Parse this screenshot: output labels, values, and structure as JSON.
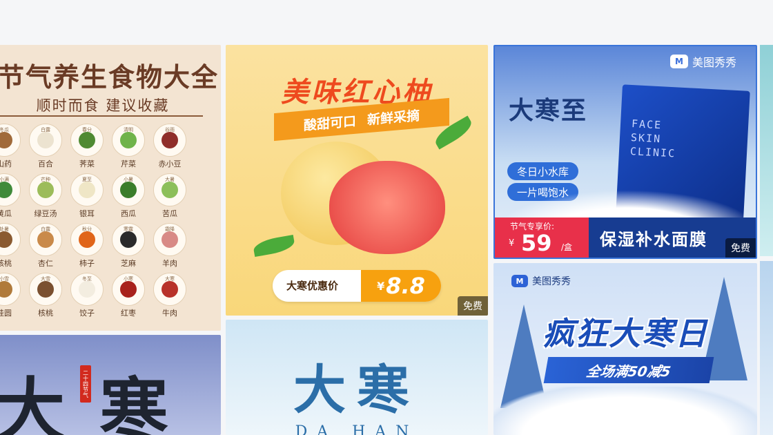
{
  "cards": [
    {
      "title": "节气养生食物大全",
      "subtitle": "顺时而食 建议收藏",
      "foods": [
        {
          "small": "冬瓜",
          "label": "山药",
          "color": "#a06a3a"
        },
        {
          "small": "白露",
          "label": "百合",
          "color": "#ece3d0"
        },
        {
          "small": "春分",
          "label": "荠菜",
          "color": "#4f8a33"
        },
        {
          "small": "清明",
          "label": "芹菜",
          "color": "#6fb34a"
        },
        {
          "small": "谷雨",
          "label": "赤小豆",
          "color": "#8f2e2a"
        },
        {
          "small": "小满",
          "label": "黄瓜",
          "color": "#3f8a3a"
        },
        {
          "small": "芒种",
          "label": "绿豆汤",
          "color": "#9cbc5a"
        },
        {
          "small": "夏至",
          "label": "银耳",
          "color": "#efe6c6"
        },
        {
          "small": "小暑",
          "label": "西瓜",
          "color": "#3a7d2a"
        },
        {
          "small": "大暑",
          "label": "苦瓜",
          "color": "#8cbf5a"
        },
        {
          "small": "处暑",
          "label": "核桃",
          "color": "#8a5a30"
        },
        {
          "small": "白露",
          "label": "杏仁",
          "color": "#c98a4a"
        },
        {
          "small": "秋分",
          "label": "柿子",
          "color": "#e0651a"
        },
        {
          "small": "寒露",
          "label": "芝麻",
          "color": "#2a2a2a"
        },
        {
          "small": "霜降",
          "label": "羊肉",
          "color": "#d88a86"
        },
        {
          "small": "小雪",
          "label": "桂圆",
          "color": "#b07a3a"
        },
        {
          "small": "大雪",
          "label": "核桃",
          "color": "#7a5030"
        },
        {
          "small": "冬至",
          "label": "饺子",
          "color": "#f3ede0"
        },
        {
          "small": "小寒",
          "label": "红枣",
          "color": "#a8221c"
        },
        {
          "small": "大寒",
          "label": "牛肉",
          "color": "#b8322a"
        }
      ]
    },
    {
      "title": "美味红心柚",
      "tag1": "酸甜可口",
      "tag2": "新鲜采摘",
      "price_label": "大寒优惠价",
      "currency": "¥",
      "price": "8.8",
      "badge": "免费"
    },
    {
      "brand": "美图秀秀",
      "headline": "大寒至",
      "pack_text_1": "FACE",
      "pack_text_2": "SKIN",
      "pack_text_3": "CLINIC",
      "pill1": "冬日小水库",
      "pill2": "一片喝饱水",
      "price_label": "节气专享价:",
      "currency": "¥",
      "price": "59",
      "unit": "/盒",
      "bottom_text": "保湿补水面膜",
      "badge": "免费"
    },
    {
      "big_text_1": "大",
      "big_text_2": "寒",
      "seal": "二十四节气"
    },
    {
      "big_text": "大寒",
      "pinyin": "DA HAN"
    },
    {
      "brand": "美图秀秀",
      "headline": "疯狂大寒日",
      "sub": "全场满50减5"
    }
  ],
  "colors": {
    "page_bg": "#f5f6f8",
    "accent_orange": "#f7a10f",
    "accent_red": "#e8304a",
    "brand_blue": "#2d62d6"
  }
}
